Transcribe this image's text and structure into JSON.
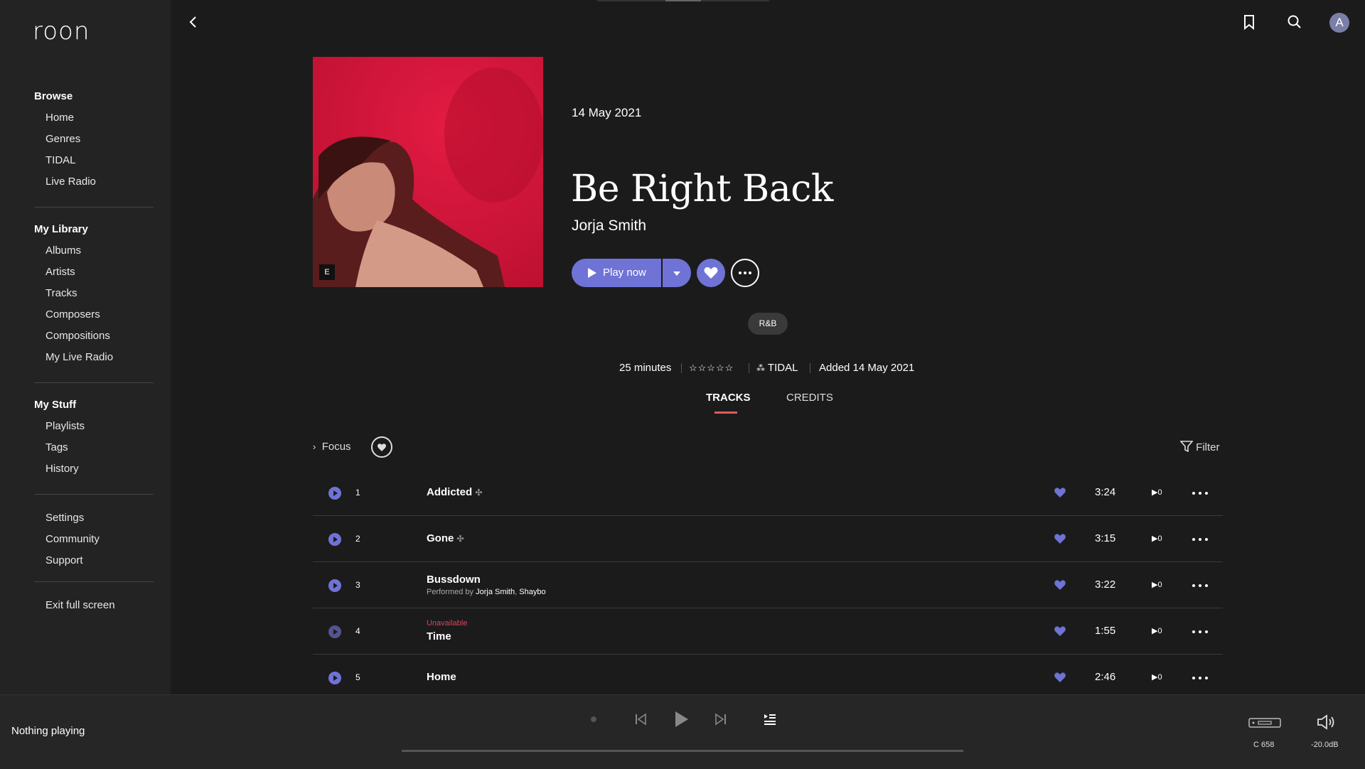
{
  "app": {
    "logo": "roon"
  },
  "sidebar": {
    "browse": {
      "heading": "Browse",
      "items": [
        "Home",
        "Genres",
        "TIDAL",
        "Live Radio"
      ]
    },
    "library": {
      "heading": "My Library",
      "items": [
        "Albums",
        "Artists",
        "Tracks",
        "Composers",
        "Compositions",
        "My Live Radio"
      ]
    },
    "stuff": {
      "heading": "My Stuff",
      "items": [
        "Playlists",
        "Tags",
        "History"
      ]
    },
    "misc": {
      "items": [
        "Settings",
        "Community",
        "Support"
      ]
    },
    "exit": "Exit full screen"
  },
  "header": {
    "avatar_initial": "A",
    "icons": [
      "back-icon",
      "bookmark-icon",
      "search-icon"
    ]
  },
  "album": {
    "date": "14 May 2021",
    "title": "Be Right Back",
    "artist": "Jorja Smith",
    "explicit_badge": "E",
    "play_label": "Play now",
    "genre": "R&B",
    "duration": "25 minutes",
    "rating_stars": 0,
    "source": "TIDAL",
    "added": "Added 14 May 2021"
  },
  "tabs": {
    "tracks": "TRACKS",
    "credits": "CREDITS",
    "active": "TRACKS"
  },
  "list_controls": {
    "focus": "Focus",
    "filter": "Filter"
  },
  "tracks": [
    {
      "num": "1",
      "name": "Addicted",
      "tidal_icon": true,
      "sub": "",
      "unavailable": "",
      "duration": "3:24",
      "plays": "0"
    },
    {
      "num": "2",
      "name": "Gone",
      "tidal_icon": true,
      "sub": "",
      "unavailable": "",
      "duration": "3:15",
      "plays": "0"
    },
    {
      "num": "3",
      "name": "Bussdown",
      "tidal_icon": false,
      "sub_prefix": "Performed by",
      "sub_artists": [
        "Jorja Smith",
        "Shaybo"
      ],
      "unavailable": "",
      "duration": "3:22",
      "plays": "0"
    },
    {
      "num": "4",
      "name": "Time",
      "tidal_icon": false,
      "sub": "",
      "unavailable": "Unavailable",
      "duration": "1:55",
      "plays": "0"
    },
    {
      "num": "5",
      "name": "Home",
      "tidal_icon": false,
      "sub": "",
      "unavailable": "",
      "duration": "2:46",
      "plays": "0"
    }
  ],
  "player": {
    "status": "Nothing playing",
    "zone_device": "C 658",
    "volume": "-20.0dB"
  },
  "colors": {
    "accent": "#6f73d6",
    "tab_underline": "#e05a5a",
    "unavailable": "#e0435a",
    "cover": "#d4163a"
  }
}
